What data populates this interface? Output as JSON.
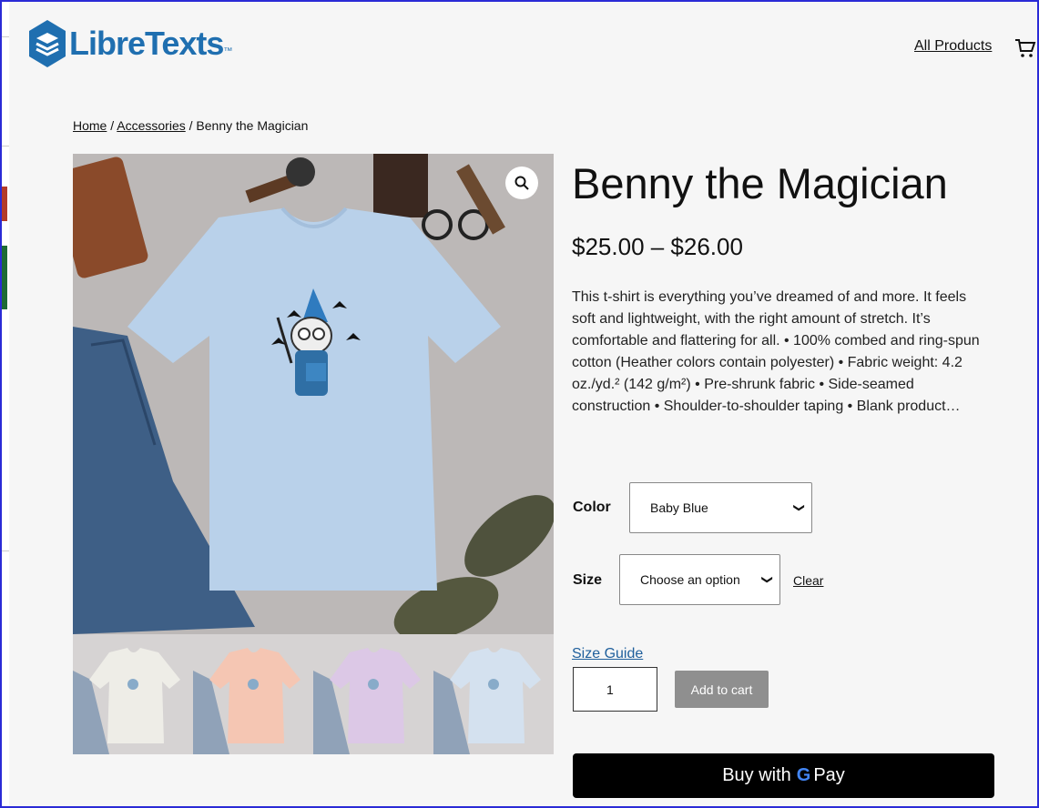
{
  "header": {
    "logo_text": "LibreTexts",
    "logo_tm": "™",
    "nav_link": "All Products"
  },
  "breadcrumb": {
    "home": "Home",
    "sep1": " / ",
    "category": "Accessories",
    "sep2": " / ",
    "current": "Benny the Magician"
  },
  "product": {
    "title": "Benny the Magician",
    "price": "$25.00 – $26.00",
    "description": "This t-shirt is everything you’ve dreamed of and more. It feels soft and lightweight, with the right amount of stretch. It’s comfortable and flattering for all. • 100% combed and ring-spun cotton (Heather colors contain polyester) • Fabric weight: 4.2 oz./yd.² (142 g/m²) • Pre-shrunk fabric • Side-seamed construction • Shoulder-to-shoulder taping • Blank product…",
    "shirt_color": "#b9d1ea",
    "thumbnails": [
      {
        "color": "#e9e6dc"
      },
      {
        "color": "#f5a07d"
      },
      {
        "color": "#c7a3d9"
      },
      {
        "color": "#b9d1ea"
      }
    ]
  },
  "options": {
    "color_label": "Color",
    "color_value": "Baby Blue",
    "size_label": "Size",
    "size_value": "Choose an option",
    "clear_label": "Clear"
  },
  "purchase": {
    "size_guide": "Size Guide",
    "quantity": "1",
    "add_to_cart": "Add to cart",
    "gpay_prefix": "Buy with",
    "gpay_g": "G",
    "gpay_suffix": "Pay"
  }
}
